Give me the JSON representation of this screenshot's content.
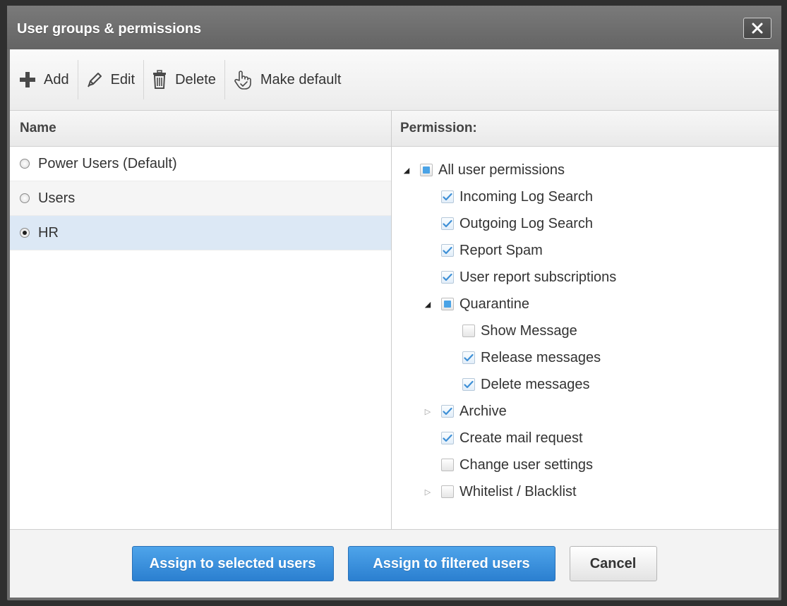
{
  "dialog": {
    "title": "User groups & permissions"
  },
  "toolbar": {
    "add_label": "Add",
    "edit_label": "Edit",
    "delete_label": "Delete",
    "make_default_label": "Make default"
  },
  "groups": {
    "header": "Name",
    "items": [
      {
        "label": "Power Users (Default)",
        "selected": false
      },
      {
        "label": "Users",
        "selected": false
      },
      {
        "label": "HR",
        "selected": true
      }
    ]
  },
  "permissions": {
    "header": "Permission:",
    "tree": [
      {
        "label": "All user permissions",
        "level": 0,
        "caret": "expanded",
        "state": "partial"
      },
      {
        "label": "Incoming Log Search",
        "level": 1,
        "caret": "none",
        "state": "checked"
      },
      {
        "label": "Outgoing Log Search",
        "level": 1,
        "caret": "none",
        "state": "checked"
      },
      {
        "label": "Report Spam",
        "level": 1,
        "caret": "none",
        "state": "checked"
      },
      {
        "label": "User report subscriptions",
        "level": 1,
        "caret": "none",
        "state": "checked"
      },
      {
        "label": "Quarantine",
        "level": 1,
        "caret": "expanded",
        "state": "partial"
      },
      {
        "label": "Show Message",
        "level": 2,
        "caret": "none",
        "state": "unchecked"
      },
      {
        "label": "Release messages",
        "level": 2,
        "caret": "none",
        "state": "checked"
      },
      {
        "label": "Delete messages",
        "level": 2,
        "caret": "none",
        "state": "checked"
      },
      {
        "label": "Archive",
        "level": 1,
        "caret": "collapsed",
        "state": "checked"
      },
      {
        "label": "Create mail request",
        "level": 1,
        "caret": "none",
        "state": "checked"
      },
      {
        "label": "Change user settings",
        "level": 1,
        "caret": "none",
        "state": "unchecked"
      },
      {
        "label": "Whitelist / Blacklist",
        "level": 1,
        "caret": "collapsed",
        "state": "unchecked"
      }
    ]
  },
  "footer": {
    "assign_selected_label": "Assign to selected users",
    "assign_filtered_label": "Assign to filtered users",
    "cancel_label": "Cancel"
  },
  "colors": {
    "titlebar": "#6d6d6d",
    "primary_button": "#2b7fd0",
    "selected_row": "#dce8f5",
    "checkbox_partial": "#4aa3e6",
    "checkmark": "#3d8fd6"
  },
  "icons": {
    "add": "plus-icon",
    "edit": "pencil-icon",
    "delete": "trash-icon",
    "make_default": "hand-pointer-icon",
    "close": "close-icon"
  }
}
